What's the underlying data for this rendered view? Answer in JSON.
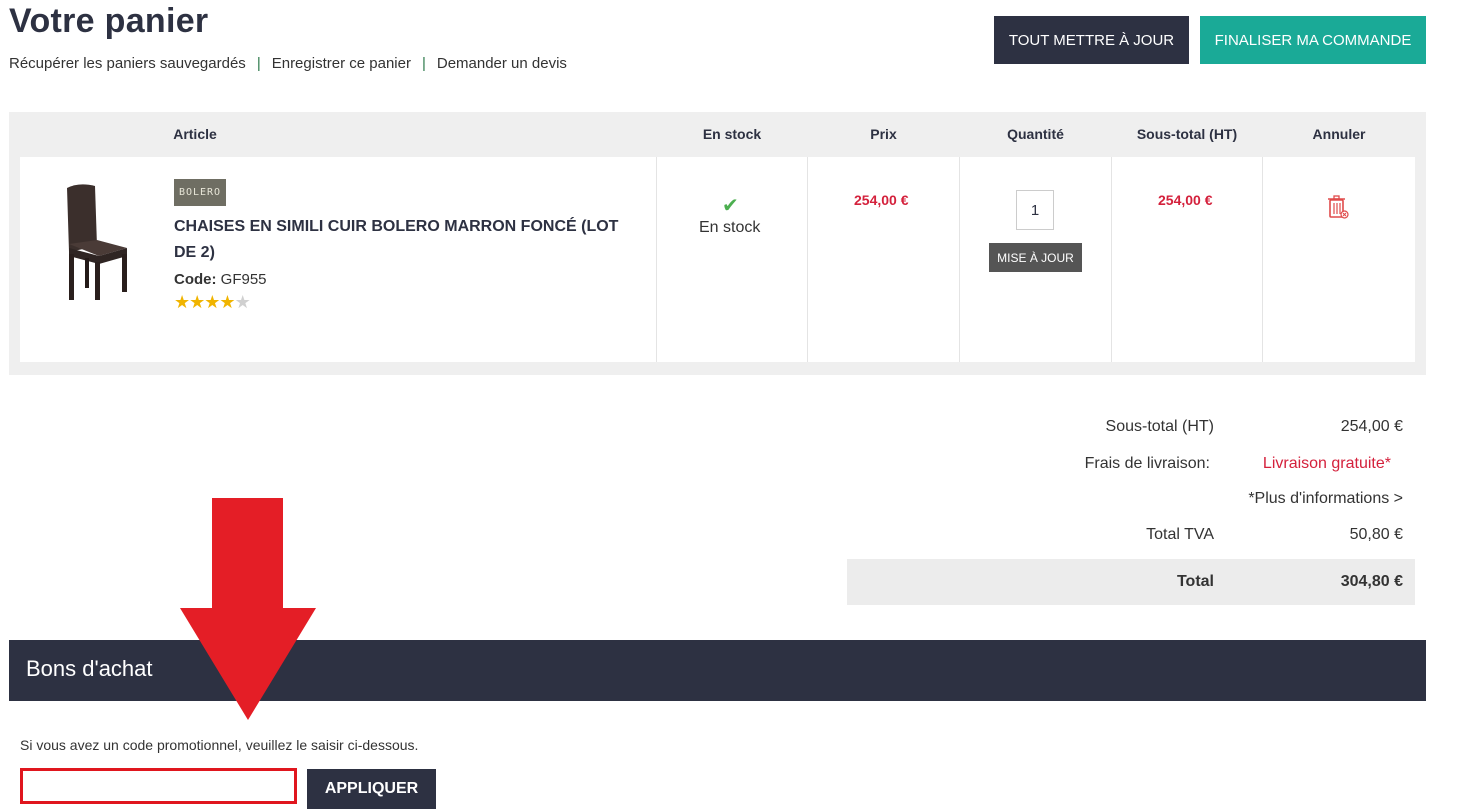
{
  "page": {
    "title": "Votre panier",
    "links": [
      "Récupérer les paniers sauvegardés",
      "Enregistrer ce panier",
      "Demander un devis"
    ],
    "update_all_label": "TOUT METTRE À JOUR",
    "checkout_label": "FINALISER MA COMMANDE"
  },
  "table": {
    "headers": {
      "article": "Article",
      "stock": "En stock",
      "price": "Prix",
      "quantity": "Quantité",
      "subtotal": "Sous-total (HT)",
      "cancel": "Annuler"
    },
    "item": {
      "brand": "BOLERO",
      "name": "CHAISES EN SIMILI CUIR BOLERO MARRON FONCÉ (LOT DE 2)",
      "code_label": "Code:",
      "code": "GF955",
      "rating": 4,
      "rating_max": 5,
      "stock_status": "En stock",
      "price": "254,00 €",
      "quantity": "1",
      "update_label": "MISE À JOUR",
      "subtotal": "254,00 €",
      "icon_stock": "check-icon",
      "icon_cancel": "trash-icon"
    }
  },
  "summary": {
    "subtotal_label": "Sous-total (HT)",
    "subtotal_value": "254,00 €",
    "shipping_label": "Frais de livraison:",
    "shipping_value": "Livraison gratuite*",
    "more_info": "*Plus d'informations >",
    "vat_label": "Total TVA",
    "vat_value": "50,80 €",
    "total_label": "Total",
    "total_value": "304,80 €"
  },
  "voucher": {
    "title": "Bons d'achat",
    "hint": "Si vous avez un code promotionnel, veuillez le saisir ci-dessous.",
    "input_value": "",
    "apply_label": "APPLIQUER"
  },
  "colors": {
    "navy": "#2d3142",
    "teal": "#1aaa97",
    "price_red": "#d4213c",
    "annotation_red": "#e41e26"
  }
}
